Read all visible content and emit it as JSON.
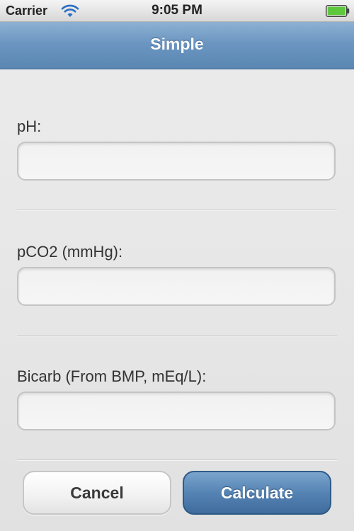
{
  "status_bar": {
    "carrier": "Carrier",
    "time": "9:05 PM",
    "wifi_icon": "wifi-icon",
    "battery_icon": "battery-icon",
    "battery_color": "#5ec83c"
  },
  "nav_bar": {
    "title": "Simple",
    "color": "#6c96c1"
  },
  "form": {
    "fields": [
      {
        "label": "pH:",
        "value": "",
        "placeholder": ""
      },
      {
        "label": "pCO2 (mmHg):",
        "value": "",
        "placeholder": ""
      },
      {
        "label": "Bicarb (From BMP, mEq/L):",
        "value": "",
        "placeholder": ""
      }
    ]
  },
  "buttons": {
    "cancel_label": "Cancel",
    "calculate_label": "Calculate",
    "calculate_color": "#4a78a8"
  }
}
